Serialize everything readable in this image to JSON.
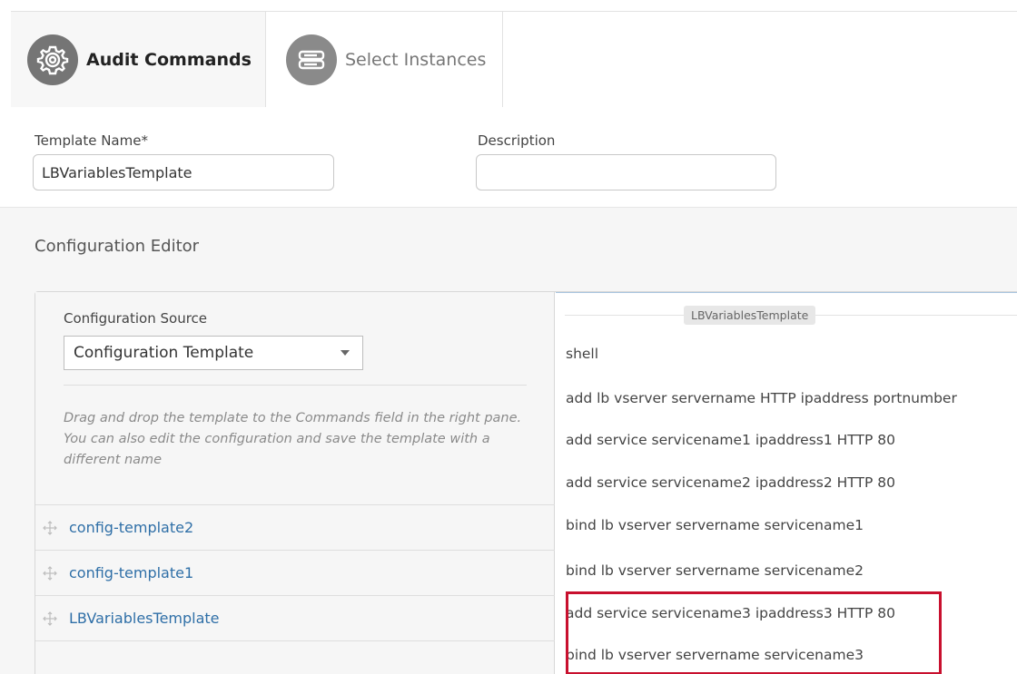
{
  "tabs": [
    {
      "label": "Audit Commands",
      "icon": "gear-icon",
      "active": true
    },
    {
      "label": "Select Instances",
      "icon": "server-icon",
      "active": false
    }
  ],
  "form": {
    "template_name_label": "Template Name*",
    "template_name_value": "LBVariablesTemplate",
    "description_label": "Description",
    "description_value": ""
  },
  "editor": {
    "title": "Configuration Editor",
    "source_label": "Configuration Source",
    "source_selected": "Configuration Template",
    "help_text": "Drag and drop the template to the Commands field in the right pane. You can also edit the configuration and save the template with a different name",
    "templates": [
      "config-template2",
      "config-template1",
      "LBVariablesTemplate"
    ],
    "commands_legend": "LBVariablesTemplate",
    "commands": [
      "shell",
      "add lb vserver servername HTTP ipaddress portnumber",
      "add service servicename1 ipaddress1 HTTP 80",
      "add service servicename2 ipaddress2 HTTP 80",
      "bind lb vserver servername servicename1",
      "bind lb vserver servername servicename2",
      "add service servicename3 ipaddress3 HTTP 80",
      "bind lb vserver servername servicename3"
    ]
  },
  "colors": {
    "link": "#2f6fa7",
    "highlight": "#c8102e",
    "tab_icon": "#757575"
  }
}
